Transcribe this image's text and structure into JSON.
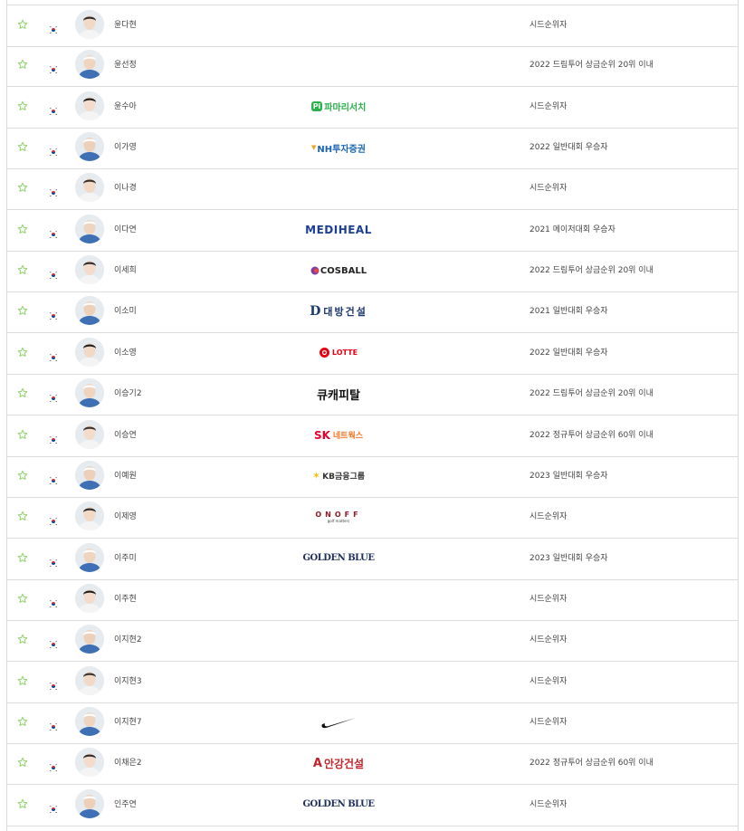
{
  "colors": {
    "star": "#8fd36a",
    "row_border": "#dcdcdc",
    "flag_red": "#cd2e3a",
    "flag_blue": "#0047a0"
  },
  "players": [
    {
      "name": "윤다현",
      "sponsor": null,
      "qualification": "시드순위자"
    },
    {
      "name": "윤선정",
      "sponsor": null,
      "qualification": "2022 드림투어 상금순위 20위 이내"
    },
    {
      "name": "윤수아",
      "sponsor": "pamarisisi",
      "qualification": "시드순위자"
    },
    {
      "name": "이가영",
      "sponsor": "nh",
      "qualification": "2022 일반대회 우승자"
    },
    {
      "name": "이나경",
      "sponsor": null,
      "qualification": "시드순위자"
    },
    {
      "name": "이다연",
      "sponsor": "mediheal",
      "qualification": "2021 메이저대회 우승자"
    },
    {
      "name": "이세희",
      "sponsor": "cosball",
      "qualification": "2022 드림투어 상금순위 20위 이내"
    },
    {
      "name": "이소미",
      "sponsor": "daebang",
      "qualification": "2021 일반대회 우승자"
    },
    {
      "name": "이소영",
      "sponsor": "lotte",
      "qualification": "2022 일반대회 우승자"
    },
    {
      "name": "이승기2",
      "sponsor": "qcapital",
      "qualification": "2022 드림투어 상금순위 20위 이내"
    },
    {
      "name": "이승연",
      "sponsor": "sk",
      "qualification": "2022 정규투어 상금순위 60위 이내"
    },
    {
      "name": "이예원",
      "sponsor": "kb",
      "qualification": "2023 일반대회 우승자"
    },
    {
      "name": "이제영",
      "sponsor": "onoff",
      "qualification": "시드순위자"
    },
    {
      "name": "이주미",
      "sponsor": "goldenblue",
      "qualification": "2023 일반대회 우승자"
    },
    {
      "name": "이주현",
      "sponsor": null,
      "qualification": "시드순위자"
    },
    {
      "name": "이지현2",
      "sponsor": null,
      "qualification": "시드순위자"
    },
    {
      "name": "이지현3",
      "sponsor": null,
      "qualification": "시드순위자"
    },
    {
      "name": "이지현7",
      "sponsor": "nike",
      "qualification": "시드순위자"
    },
    {
      "name": "이채은2",
      "sponsor": "angang",
      "qualification": "2022 정규투어 상금순위 60위 이내"
    },
    {
      "name": "인주연",
      "sponsor": "goldenblue",
      "qualification": "시드순위자"
    }
  ],
  "sponsor_logos": {
    "pamarisisi": {
      "mark": "Pi",
      "text": "파마리서치",
      "color": "#2bb24c"
    },
    "nh": {
      "text": "NH투자증권",
      "color": "#1a66b3",
      "accent": "#f3a21b"
    },
    "mediheal": {
      "text": "MEDIHEAL",
      "color": "#1c3f94"
    },
    "cosball": {
      "text": "COSBALL",
      "color": "#222222"
    },
    "daebang": {
      "mark": "D",
      "text": "대방건설",
      "color": "#1d3a6e"
    },
    "lotte": {
      "text": "LOTTE",
      "color": "#e60012"
    },
    "qcapital": {
      "text": "큐캐피탈",
      "color": "#111111"
    },
    "sk": {
      "mark": "SK",
      "text": "네트웍스",
      "color": "#ea002c",
      "accent": "#f47725"
    },
    "kb": {
      "text": "KB금융그룹",
      "color": "#333333",
      "accent": "#ffbc00"
    },
    "onoff": {
      "text": "ONOFF",
      "sub": "golf matters",
      "color": "#8a1f2a"
    },
    "goldenblue": {
      "text": "GOLDEN BLUE",
      "color": "#1d2d5c"
    },
    "nike": {
      "text": "",
      "color": "#111111"
    },
    "angang": {
      "mark": "A",
      "text": "안강건설",
      "color": "#c0252b"
    }
  }
}
